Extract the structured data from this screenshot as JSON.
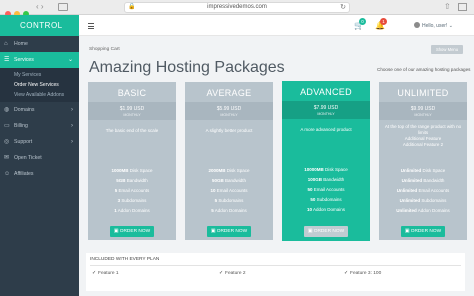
{
  "browser": {
    "url": "impressivedemos.com",
    "lock_glyph": "🔒",
    "reload_glyph": "↻",
    "back_forward": "‹ ›",
    "share_glyph": "⇧"
  },
  "sidebar": {
    "brand": "CONTROL",
    "items": [
      {
        "label": "Home",
        "icon": "home-icon",
        "glyph": "⌂"
      },
      {
        "label": "Services",
        "icon": "services-icon",
        "glyph": "☰",
        "chevron": "⌄"
      },
      {
        "label": "Domains",
        "icon": "globe-icon",
        "glyph": "◍",
        "chevron": "›"
      },
      {
        "label": "Billing",
        "icon": "billing-icon",
        "glyph": "▭",
        "chevron": "›"
      },
      {
        "label": "Support",
        "icon": "support-icon",
        "glyph": "◎",
        "chevron": "›"
      },
      {
        "label": "Open Ticket",
        "icon": "ticket-icon",
        "glyph": "✉"
      },
      {
        "label": "Affiliates",
        "icon": "affiliates-icon",
        "glyph": "☺"
      }
    ],
    "submenu": [
      "My Services",
      "Order New Services",
      "View Available Addons"
    ]
  },
  "topbar": {
    "cart_badge": "0",
    "bell_badge": "1",
    "cart_glyph": "🛒",
    "bell_glyph": "🔔",
    "user": "Hello, user!",
    "user_chev": "⌄"
  },
  "content": {
    "breadcrumb": "Shopping Cart",
    "show_menu": "Show Menu",
    "title": "Amazing Hosting Packages",
    "subtitle": "Choose one of our amazing hosting packages",
    "plans": [
      {
        "name": "BASIC",
        "price": "$1.99 USD",
        "cycle": "MONTHLY",
        "desc": "The basic end of the scale",
        "features": [
          {
            "v": "1000MB",
            "l": " Disk Space"
          },
          {
            "v": "5GB",
            "l": " Bandwidth"
          },
          {
            "v": "5",
            "l": " Email Accounts"
          },
          {
            "v": "3",
            "l": " Subdomains"
          },
          {
            "v": "1",
            "l": " Addon Domains"
          }
        ],
        "order": "ORDER NOW"
      },
      {
        "name": "AVERAGE",
        "price": "$5.99 USD",
        "cycle": "MONTHLY",
        "desc": "A slightly better product",
        "features": [
          {
            "v": "2000MB",
            "l": " Disk Space"
          },
          {
            "v": "50GB",
            "l": " Bandwidth"
          },
          {
            "v": "10",
            "l": " Email Accounts"
          },
          {
            "v": "5",
            "l": " Subdomains"
          },
          {
            "v": "5",
            "l": " Addon Domains"
          }
        ],
        "order": "ORDER NOW"
      },
      {
        "name": "ADVANCED",
        "price": "$7.99 USD",
        "cycle": "MONTHLY",
        "desc": "A more advanced product",
        "features": [
          {
            "v": "10000MB",
            "l": " Disk Space"
          },
          {
            "v": "100GB",
            "l": " Bandwidth"
          },
          {
            "v": "50",
            "l": " Email Accounts"
          },
          {
            "v": "50",
            "l": " Subdomains"
          },
          {
            "v": "10",
            "l": " Addon Domains"
          }
        ],
        "order": "ORDER NOW"
      },
      {
        "name": "UNLIMITED",
        "price": "$9.99 USD",
        "cycle": "MONTHLY",
        "desc": "At the top of the range product with no limits\nAdditional Feature\nAdditional Feature 2",
        "features": [
          {
            "v": "Unlimited",
            "l": " Disk Space"
          },
          {
            "v": "Unlimited",
            "l": " Bandwidth"
          },
          {
            "v": "Unlimited",
            "l": " Email Accounts"
          },
          {
            "v": "Unlimited",
            "l": " Subdomains"
          },
          {
            "v": "Unlimited",
            "l": " Addon Domains"
          }
        ],
        "order": "ORDER NOW"
      }
    ],
    "included": {
      "head": "INCLUDED WITH EVERY PLAN",
      "items": [
        "Feature 1",
        "Feature 2",
        "Feature 3: 100"
      ]
    }
  },
  "colors": {
    "accent": "#1abc9c",
    "sidebar": "#2e3d4a",
    "plan": "#b8c4cc",
    "cart_badge": "#1abc9c",
    "bell_badge": "#e74c3c"
  }
}
